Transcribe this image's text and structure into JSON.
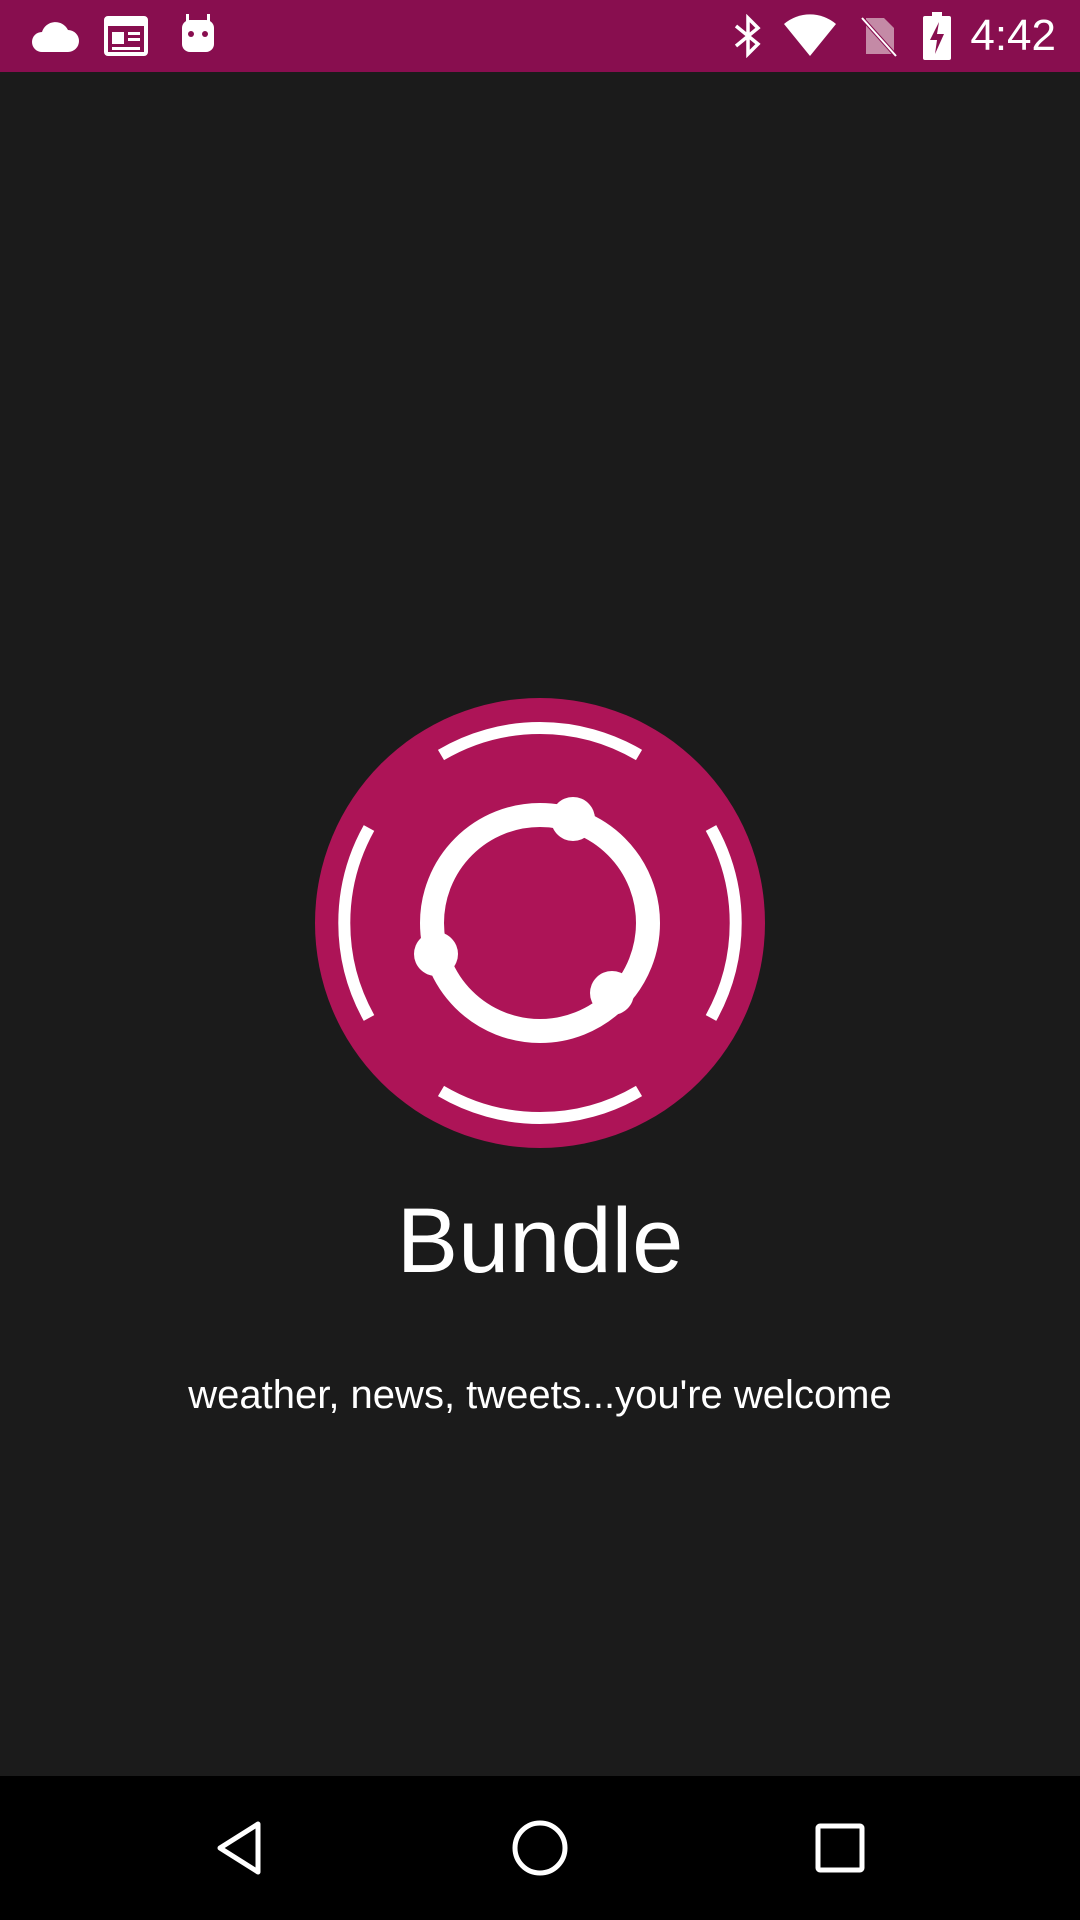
{
  "status_bar": {
    "time": "4:42",
    "left_icons": [
      "cloud-icon",
      "news-calendar-icon",
      "android-icon"
    ],
    "right_icons": [
      "bluetooth-icon",
      "wifi-icon",
      "no-sim-icon",
      "battery-charging-icon"
    ],
    "background": "#880e4f"
  },
  "splash": {
    "title": "Bundle",
    "tagline": "weather, news, tweets...you're welcome",
    "logo_icon": "bundle-logo-icon",
    "logo_color": "#ad1457",
    "background": "#1b1b1b"
  },
  "nav_bar": {
    "buttons": [
      "back-icon",
      "home-icon",
      "recents-icon"
    ]
  }
}
